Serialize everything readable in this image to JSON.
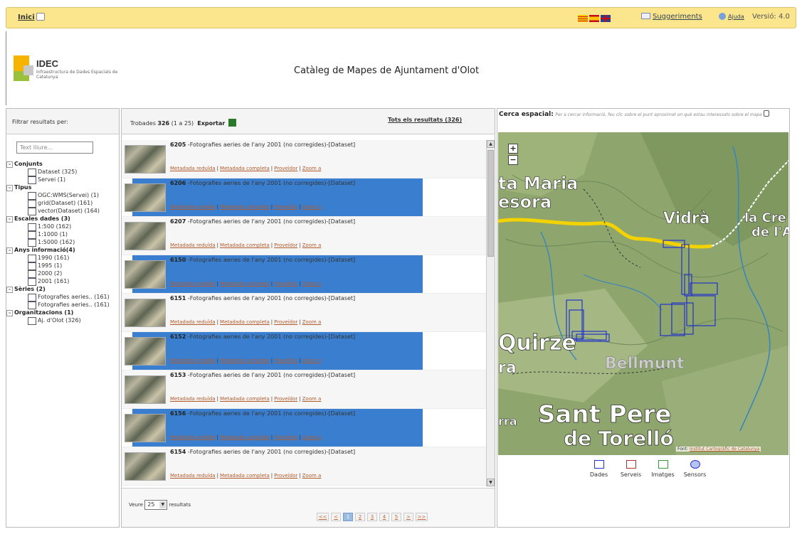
{
  "topbar": {
    "home_label": "Inici",
    "languages": [
      "cat-flag",
      "es-flag",
      "uk-flag"
    ],
    "suggestions": "Suggeriments",
    "help": "Ajuda",
    "version": "Versió: 4.0"
  },
  "header": {
    "logo_title": "IDEC",
    "logo_sub": "Infraestructura de Dades Espacials de Catalunya",
    "title": "Catàleg de Mapes de Ajuntament d'Olot"
  },
  "filters": {
    "label": "Filtrar resultats per:",
    "free_text_placeholder": "Text lliure...",
    "groups": [
      {
        "label": "Conjunts",
        "items": [
          "Dataset (325)",
          "Servei (1)"
        ]
      },
      {
        "label": "Tipus",
        "items": [
          "OGC:WMS(Servei) (1)",
          "grid(Dataset) (161)",
          "vector(Dataset) (164)"
        ]
      },
      {
        "label": "Escales dades (3)",
        "items": [
          "1:500 (162)",
          "1:1000 (1)",
          "1:5000 (162)"
        ]
      },
      {
        "label": "Anys informació(4)",
        "items": [
          "1990 (161)",
          "1995 (1)",
          "2000 (2)",
          "2001 (161)"
        ]
      },
      {
        "label": "Sèries (2)",
        "items": [
          "Fotografies aeries.. (161)",
          "Fotografies aeries.. (161)"
        ]
      },
      {
        "label": "Organitzacions (1)",
        "items": [
          "Aj. d'Olot (326)"
        ]
      }
    ]
  },
  "results": {
    "found_prefix": "Trobades",
    "found_count": "326",
    "found_range": "(1 a 25)",
    "export_label": "Exportar",
    "all_results": "Tots els resultats (326)",
    "links": [
      "Metadada reduïda",
      "Metadada completa",
      "Proveïdor",
      "Zoom a"
    ],
    "items": [
      {
        "id": "6205",
        "text": " -Fotografies aeries de l'any 2001 (no corregides)-[Dataset]"
      },
      {
        "id": "6206",
        "text": " -Fotografies aeries de l'any 2001 (no corregides)-[Dataset]"
      },
      {
        "id": "6207",
        "text": " -Fotografies aeries de l'any 2001 (no corregides)-[Dataset]"
      },
      {
        "id": "6150",
        "text": " -Fotografies aeries de l'any 2001 (no corregides)-[Dataset]"
      },
      {
        "id": "6151",
        "text": " -Fotografies aeries de l'any 2001 (no corregides)-[Dataset]"
      },
      {
        "id": "6152",
        "text": " -Fotografies aeries de l'any 2001 (no corregides)-[Dataset]"
      },
      {
        "id": "6153",
        "text": " -Fotografies aeries de l'any 2001 (no corregides)-[Dataset]"
      },
      {
        "id": "6156",
        "text": " -Fotografies aeries de l'any 2001 (no corregides)-[Dataset]"
      },
      {
        "id": "6154",
        "text": " -Fotografies aeries de l'any 2001 (no corregides)-[Dataset]"
      }
    ],
    "show_label": "Veure",
    "per_page": "25",
    "results_label": "resultats",
    "pager": [
      "<<",
      "<",
      "1",
      "2",
      "3",
      "4",
      "5",
      ">",
      ">>"
    ],
    "active_page": "1"
  },
  "map": {
    "cerca_label": "Cerca espacial:",
    "cerca_hint": "Per a cercar informació, feu clic sobre el punt aproximat on què estau interessats sobre el mapa",
    "place_labels": [
      "ta Maria",
      "esora",
      "Vidrà",
      "la Cre",
      "de l'Ar",
      "Quirze",
      "Sant Pere",
      "de Torelló",
      "Bellmunt",
      "ra",
      "rra"
    ],
    "credit_prefix": "Font:",
    "credit_link": "Institut Cartogràfic de Catalunya",
    "zoom_in": "+",
    "zoom_out": "−",
    "legend": [
      {
        "label": "Dades",
        "color": "#2233cc"
      },
      {
        "label": "Serveis",
        "color": "#b03030"
      },
      {
        "label": "Imatges",
        "color": "#3a9a3a"
      },
      {
        "label": "Sensors",
        "color": "#2233cc"
      }
    ]
  }
}
